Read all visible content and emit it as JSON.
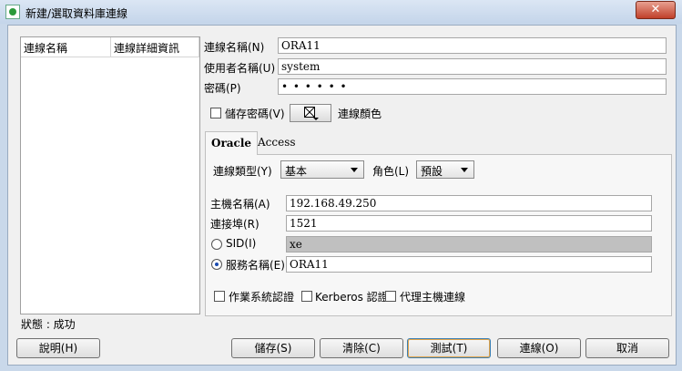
{
  "window": {
    "title": "新建/選取資料庫連線",
    "close_icon": "✕"
  },
  "list": {
    "columns": [
      "連線名稱",
      "連線詳細資訊"
    ]
  },
  "connection": {
    "name_label": "連線名稱(N)",
    "name_value": "ORA11",
    "user_label": "使用者名稱(U)",
    "user_value": "system",
    "password_label": "密碼(P)",
    "password_value": "• • • • • •",
    "save_password_label": "儲存密碼(V)",
    "save_password_checked": false,
    "color_label": "連線顏色"
  },
  "tabs": [
    {
      "label": "Oracle",
      "active": true
    },
    {
      "label": "Access",
      "active": false
    }
  ],
  "oracle": {
    "conn_type_label": "連線類型(Y)",
    "conn_type_value": "基本",
    "role_label": "角色(L)",
    "role_value": "預設",
    "host_label": "主機名稱(A)",
    "host_value": "192.168.49.250",
    "port_label": "連接埠(R)",
    "port_value": "1521",
    "sid_label": "SID(I)",
    "sid_value": "xe",
    "sid_selected": false,
    "service_label": "服務名稱(E)",
    "service_value": "ORA11",
    "service_selected": true,
    "os_auth_label": "作業系統認證",
    "kerberos_label": "Kerberos 認證",
    "proxy_label": "代理主機連線"
  },
  "status": "狀態 : 成功",
  "buttons": {
    "help": "說明(H)",
    "save": "儲存(S)",
    "clear": "清除(C)",
    "test": "測試(T)",
    "connect": "連線(O)",
    "cancel": "取消"
  }
}
